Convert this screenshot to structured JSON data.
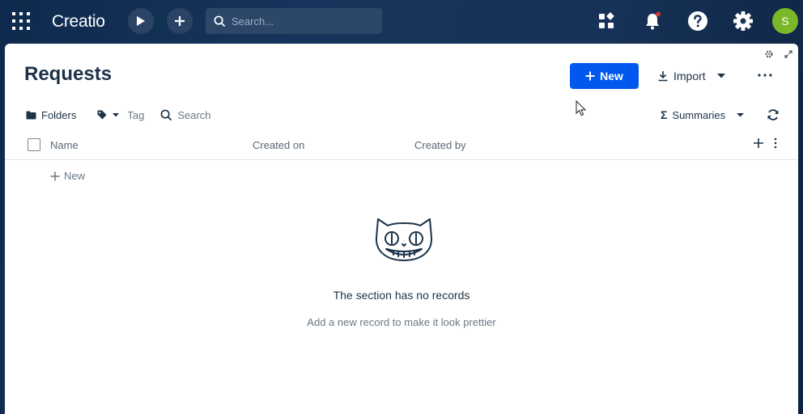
{
  "topbar": {
    "logo": "Creatio",
    "search_placeholder": "Search...",
    "avatar_initial": "S",
    "accent_color": "#0058ef",
    "avatar_color": "#7ab829"
  },
  "page": {
    "title": "Requests",
    "new_button": "New",
    "import_button": "Import"
  },
  "filters": {
    "folders": "Folders",
    "tag": "Tag",
    "search_placeholder": "Search",
    "summaries": "Summaries"
  },
  "grid": {
    "columns": [
      "Name",
      "Created on",
      "Created by"
    ],
    "add_row_label": "New"
  },
  "empty_state": {
    "title": "The section has no records",
    "subtitle": "Add a new record to make it look prettier"
  },
  "icons": [
    "apps-grid-icon",
    "play-icon",
    "plus-icon",
    "search-icon",
    "app-tiles-icon",
    "bell-icon",
    "help-icon",
    "gear-icon",
    "folder-icon",
    "tag-icon",
    "sigma-icon",
    "refresh-icon",
    "download-icon",
    "ellipsis-icon",
    "cat-illustration"
  ]
}
